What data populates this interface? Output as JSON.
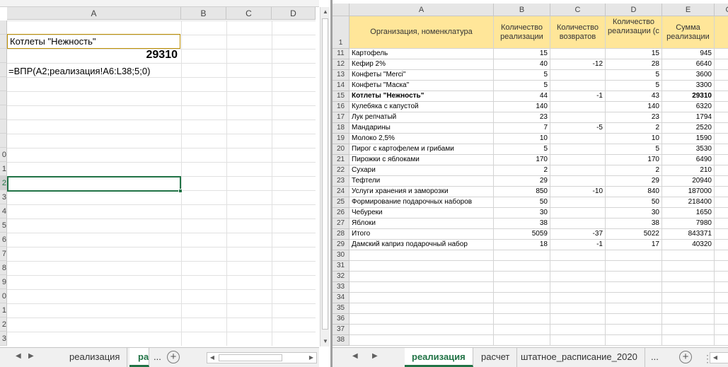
{
  "left_pane": {
    "columns": [
      "A",
      "B",
      "C",
      "D"
    ],
    "row_numbers": [
      "",
      "",
      "",
      "",
      "",
      "",
      "",
      "",
      "",
      "0",
      "1",
      "2",
      "3",
      "4",
      "5",
      "6",
      "7",
      "8",
      "9",
      "0",
      "1",
      "2",
      "3"
    ],
    "cells": {
      "a2": "Котлеты \"Нежность\"",
      "a3": "29310",
      "a4": "=ВПР(A2;реализация!A6:L38;5;0)"
    },
    "tabs": [
      "реализация",
      "ра"
    ],
    "more_tabs": "...",
    "add_sheet": "+"
  },
  "right_pane": {
    "columns": [
      "A",
      "B",
      "C",
      "D",
      "E",
      "C"
    ],
    "header_row_number": "1",
    "headers": [
      "Организация, номенклатура",
      "Количество реализации",
      "Количество возвратов",
      "Количество реализации (с",
      "Сумма реализации"
    ],
    "rows": [
      {
        "n": "11",
        "a": "Картофель",
        "b": "15",
        "c": "",
        "d": "15",
        "e": "945",
        "bold": false
      },
      {
        "n": "12",
        "a": "Кефир 2%",
        "b": "40",
        "c": "-12",
        "d": "28",
        "e": "6640",
        "bold": false
      },
      {
        "n": "13",
        "a": "Конфеты \"Merci\"",
        "b": "5",
        "c": "",
        "d": "5",
        "e": "3600",
        "bold": false
      },
      {
        "n": "14",
        "a": "Конфеты \"Маска\"",
        "b": "5",
        "c": "",
        "d": "5",
        "e": "3300",
        "bold": false
      },
      {
        "n": "15",
        "a": "Котлеты \"Нежность\"",
        "b": "44",
        "c": "-1",
        "d": "43",
        "e": "29310",
        "bold": true
      },
      {
        "n": "16",
        "a": "Кулебяка с капустой",
        "b": "140",
        "c": "",
        "d": "140",
        "e": "6320",
        "bold": false
      },
      {
        "n": "17",
        "a": "Лук репчатый",
        "b": "23",
        "c": "",
        "d": "23",
        "e": "1794",
        "bold": false
      },
      {
        "n": "18",
        "a": "Мандарины",
        "b": "7",
        "c": "-5",
        "d": "2",
        "e": "2520",
        "bold": false
      },
      {
        "n": "19",
        "a": "Молоко 2,5%",
        "b": "10",
        "c": "",
        "d": "10",
        "e": "1590",
        "bold": false
      },
      {
        "n": "20",
        "a": "Пирог с картофелем и грибами",
        "b": "5",
        "c": "",
        "d": "5",
        "e": "3530",
        "bold": false
      },
      {
        "n": "21",
        "a": "Пирожки с яблоками",
        "b": "170",
        "c": "",
        "d": "170",
        "e": "6490",
        "bold": false
      },
      {
        "n": "22",
        "a": "Сухари",
        "b": "2",
        "c": "",
        "d": "2",
        "e": "210",
        "bold": false
      },
      {
        "n": "23",
        "a": "Тефтели",
        "b": "29",
        "c": "",
        "d": "29",
        "e": "20940",
        "bold": false
      },
      {
        "n": "24",
        "a": "Услуги хранения и заморозки",
        "b": "850",
        "c": "-10",
        "d": "840",
        "e": "187000",
        "bold": false
      },
      {
        "n": "25",
        "a": "Формирование подарочных наборов",
        "b": "50",
        "c": "",
        "d": "50",
        "e": "218400",
        "bold": false
      },
      {
        "n": "26",
        "a": "Чебуреки",
        "b": "30",
        "c": "",
        "d": "30",
        "e": "1650",
        "bold": false
      },
      {
        "n": "27",
        "a": "Яблоки",
        "b": "38",
        "c": "",
        "d": "38",
        "e": "7980",
        "bold": false
      },
      {
        "n": "28",
        "a": "Итого",
        "b": "5059",
        "c": "-37",
        "d": "5022",
        "e": "843371",
        "bold": false
      },
      {
        "n": "29",
        "a": "Дамский каприз подарочный набор",
        "b": "18",
        "c": "-1",
        "d": "17",
        "e": "40320",
        "bold": false
      }
    ],
    "empty_rows": [
      "30",
      "31",
      "32",
      "33",
      "34",
      "35",
      "36",
      "37",
      "38"
    ],
    "tabs": [
      "реализация",
      "расчет",
      "штатное_расписание_2020"
    ],
    "active_tab": 0,
    "more_tabs": "...",
    "add_sheet": "+"
  }
}
